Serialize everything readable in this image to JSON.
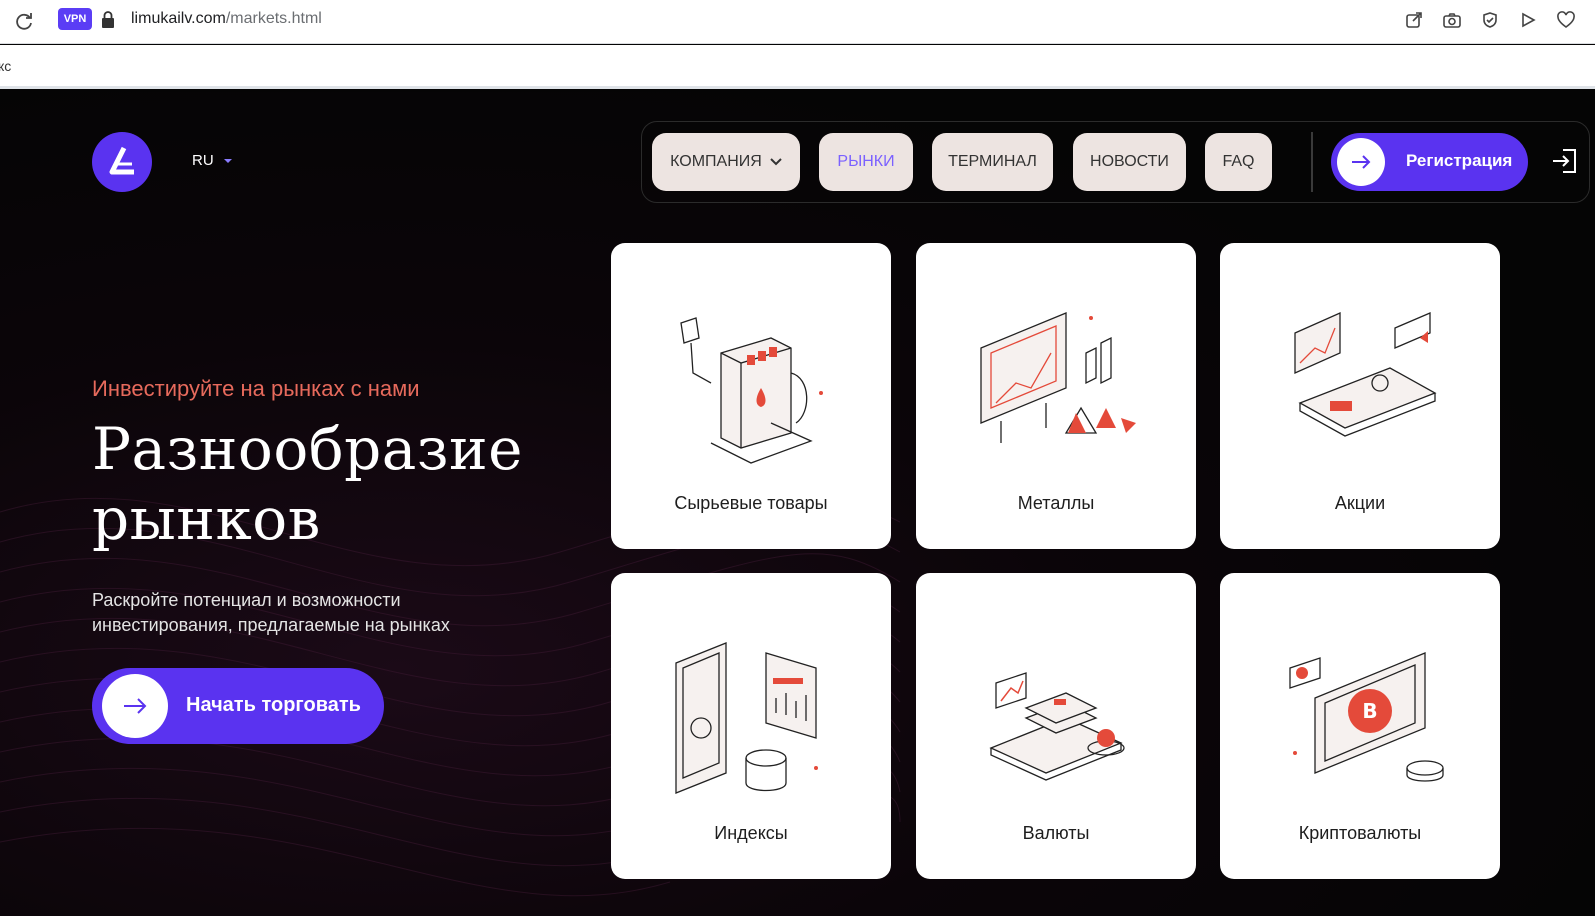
{
  "browser": {
    "vpn_label": "VPN",
    "url_host": "limukailv.com",
    "url_path": "/markets.html",
    "bookmark_fragment": "кс"
  },
  "header": {
    "lang": "RU",
    "nav": [
      {
        "label": "КОМПАНИЯ"
      },
      {
        "label": "РЫНКИ"
      },
      {
        "label": "ТЕРМИНАЛ"
      },
      {
        "label": "НОВОСТИ"
      },
      {
        "label": "FAQ"
      }
    ],
    "register_label": "Регистрация"
  },
  "hero": {
    "subtitle": "Инвестируйте на рынках с нами",
    "title_line1": "Разнообразие",
    "title_line2": "рынков",
    "desc_line1": "Раскройте потенциал и возможности",
    "desc_line2": "инвестирования, предлагаемые на рынках",
    "cta_label": "Начать торговать"
  },
  "markets": [
    {
      "title": "Сырьевые товары",
      "icon": "gas-pump-icon"
    },
    {
      "title": "Металлы",
      "icon": "metals-board-icon"
    },
    {
      "title": "Акции",
      "icon": "stocks-chart-icon"
    },
    {
      "title": "Индексы",
      "icon": "indices-phone-icon"
    },
    {
      "title": "Валюты",
      "icon": "currency-cash-icon"
    },
    {
      "title": "Криптовалюты",
      "icon": "bitcoin-tablet-icon"
    }
  ],
  "colors": {
    "accent": "#5a33f0",
    "accent_text": "#7b61ff",
    "coral": "#e76a5c",
    "nav_pill": "#ede4e1",
    "background": "#050505"
  }
}
